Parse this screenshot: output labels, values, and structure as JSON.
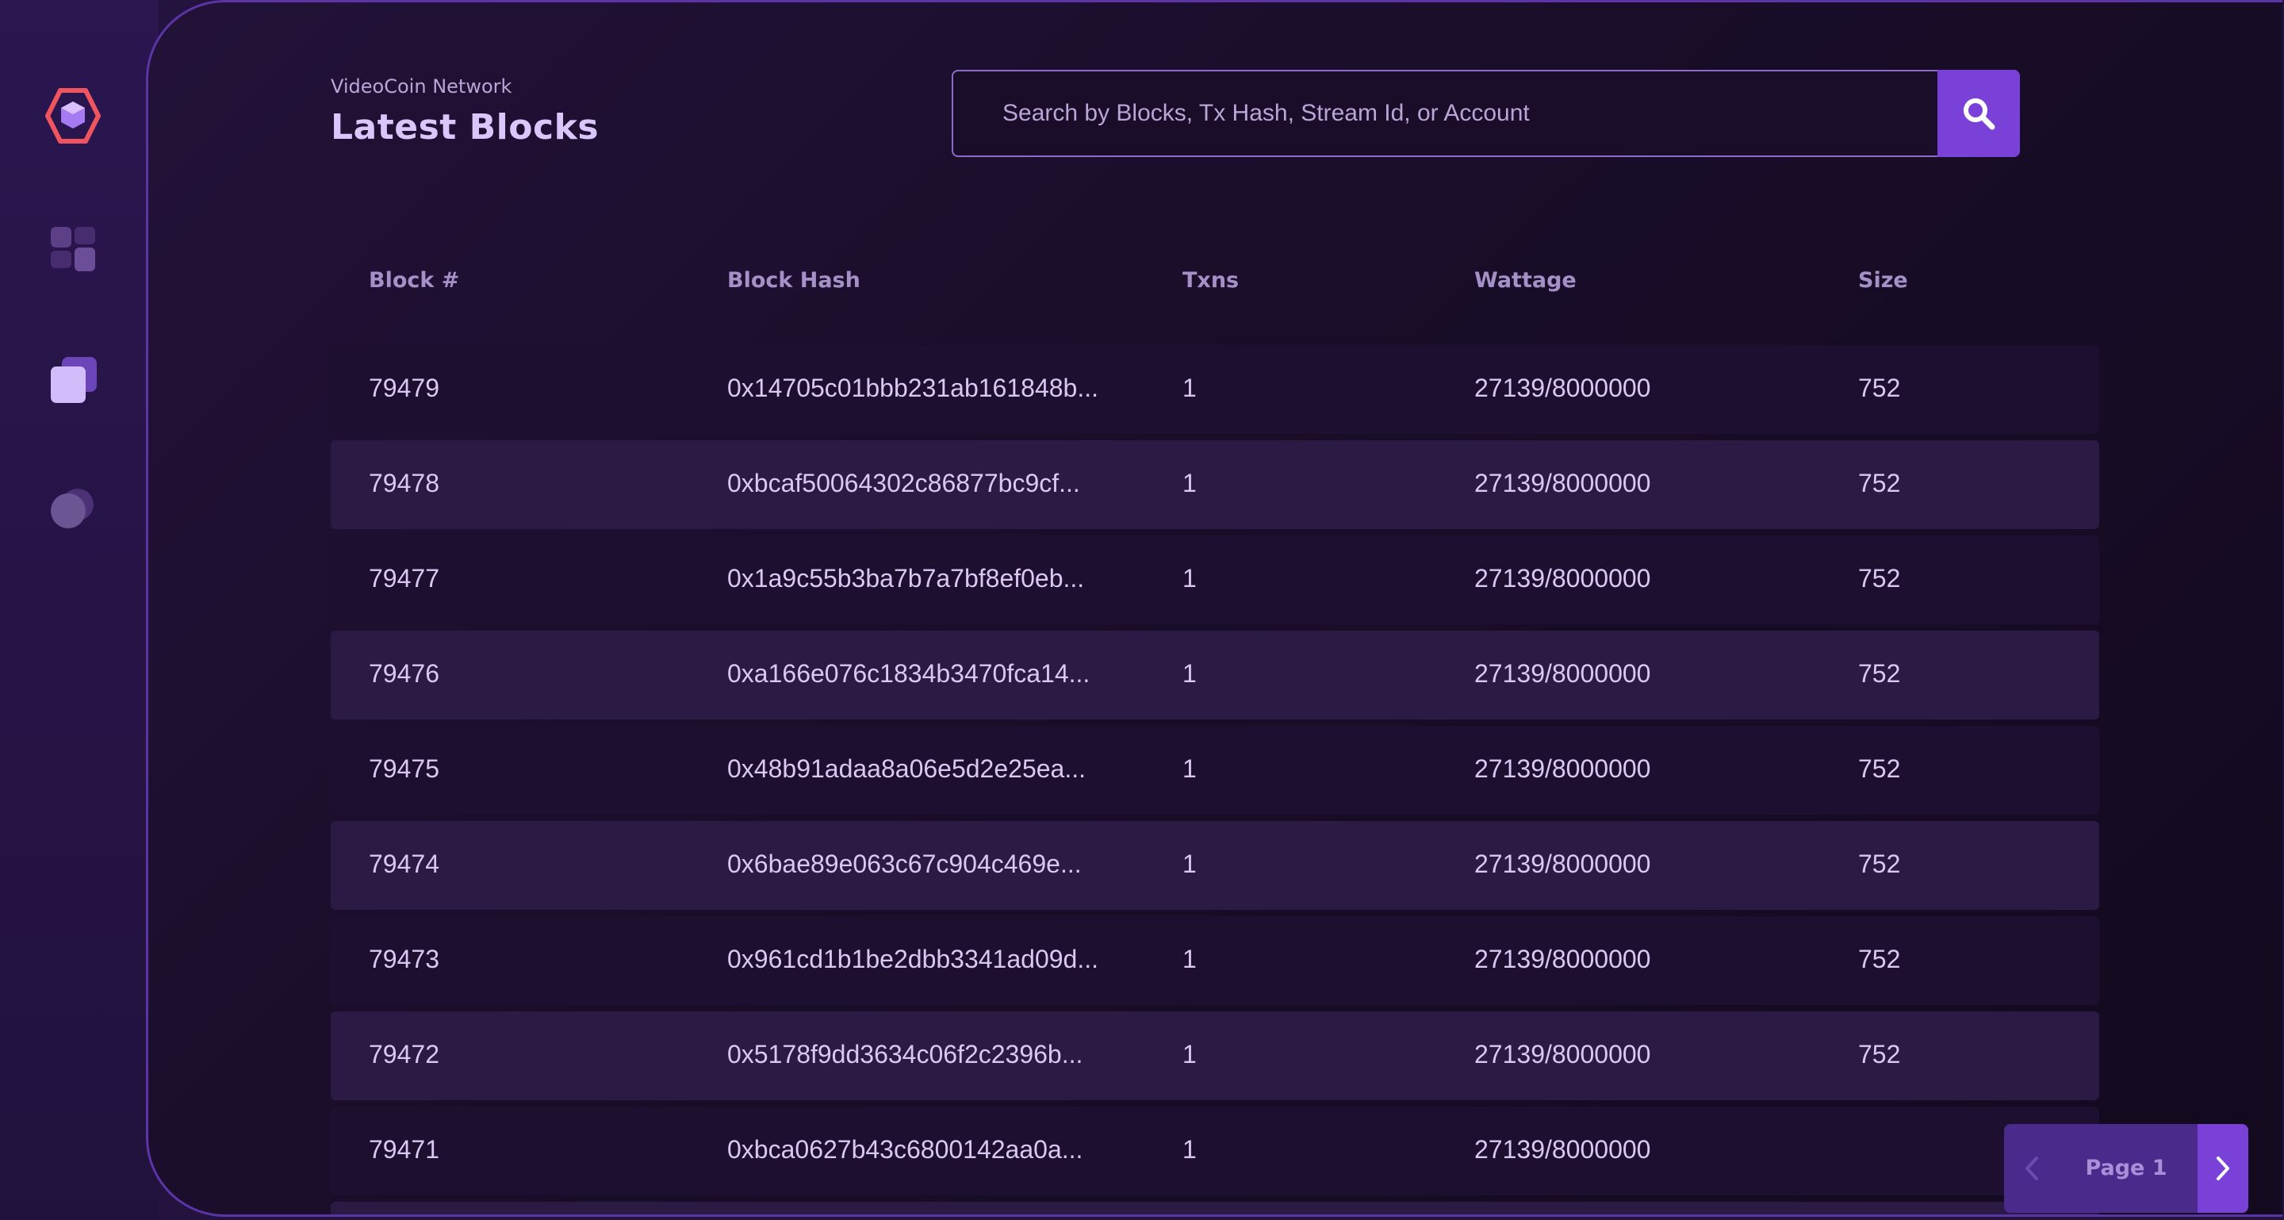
{
  "sidebar": {
    "icons": [
      "logo-hexagon-icon",
      "dashboard-icon",
      "blocks-icon",
      "accounts-icon"
    ]
  },
  "header": {
    "network": "VideoCoin Network",
    "title": "Latest Blocks"
  },
  "search": {
    "placeholder": "Search by Blocks, Tx Hash, Stream Id, or Account"
  },
  "table": {
    "columns": [
      "Block #",
      "Block Hash",
      "Txns",
      "Wattage",
      "Size"
    ],
    "rows": [
      {
        "block": "79479",
        "hash": "0x14705c01bbb231ab161848b...",
        "txns": "1",
        "wattage": "27139/8000000",
        "size": "752"
      },
      {
        "block": "79478",
        "hash": "0xbcaf50064302c86877bc9cf...",
        "txns": "1",
        "wattage": "27139/8000000",
        "size": "752"
      },
      {
        "block": "79477",
        "hash": "0x1a9c55b3ba7b7a7bf8ef0eb...",
        "txns": "1",
        "wattage": "27139/8000000",
        "size": "752"
      },
      {
        "block": "79476",
        "hash": "0xa166e076c1834b3470fca14...",
        "txns": "1",
        "wattage": "27139/8000000",
        "size": "752"
      },
      {
        "block": "79475",
        "hash": "0x48b91adaa8a06e5d2e25ea...",
        "txns": "1",
        "wattage": "27139/8000000",
        "size": "752"
      },
      {
        "block": "79474",
        "hash": "0x6bae89e063c67c904c469e...",
        "txns": "1",
        "wattage": "27139/8000000",
        "size": "752"
      },
      {
        "block": "79473",
        "hash": "0x961cd1b1be2dbb3341ad09d...",
        "txns": "1",
        "wattage": "27139/8000000",
        "size": "752"
      },
      {
        "block": "79472",
        "hash": "0x5178f9dd3634c06f2c2396b...",
        "txns": "1",
        "wattage": "27139/8000000",
        "size": "752"
      },
      {
        "block": "79471",
        "hash": "0xbca0627b43c6800142aa0a...",
        "txns": "1",
        "wattage": "27139/8000000",
        "size": ""
      }
    ]
  },
  "pagination": {
    "label": "Page 1"
  },
  "colors": {
    "accent": "#7a41d8",
    "logo": "#f0555f",
    "title": "#d9c6fb"
  }
}
